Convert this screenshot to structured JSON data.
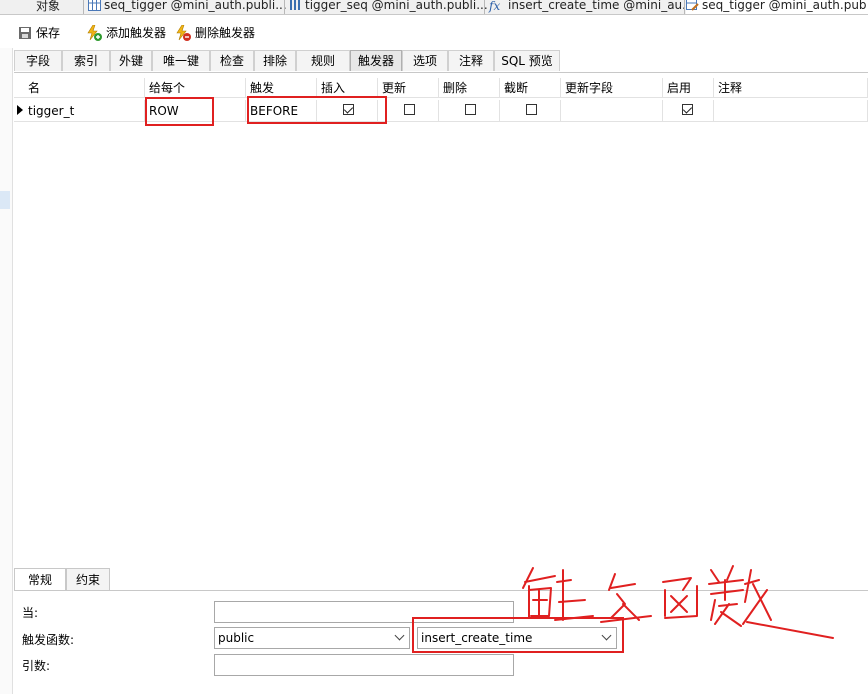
{
  "object_tabs": [
    {
      "label": "对象",
      "icon": "none"
    },
    {
      "label": "seq_tigger @mini_auth.publi...",
      "icon": "table-icon"
    },
    {
      "label": "tigger_seq @mini_auth.publi...",
      "icon": "sequence-icon"
    },
    {
      "label": "insert_create_time @mini_au...",
      "icon": "function-icon"
    },
    {
      "label": "seq_tigger @mini_auth.pub",
      "icon": "table-design-icon"
    }
  ],
  "toolbar": {
    "save_label": "保存",
    "add_trigger_label": "添加触发器",
    "delete_trigger_label": "删除触发器"
  },
  "design_tabs": [
    "字段",
    "索引",
    "外键",
    "唯一键",
    "检查",
    "排除",
    "规则",
    "触发器",
    "选项",
    "注释",
    "SQL 预览"
  ],
  "active_design_tab": "触发器",
  "grid": {
    "columns": [
      "名",
      "给每个",
      "触发",
      "插入",
      "更新",
      "删除",
      "截断",
      "更新字段",
      "启用",
      "注释"
    ],
    "rows": [
      {
        "name": "tigger_t",
        "for_each": "ROW",
        "fires": "BEFORE",
        "insert": true,
        "update": false,
        "delete": false,
        "truncate": false,
        "update_fields": "",
        "enabled": true,
        "comment": ""
      }
    ]
  },
  "bottom_tabs": [
    "常规",
    "约束"
  ],
  "active_bottom_tab": "常规",
  "form": {
    "when_label": "当:",
    "when_value": "",
    "trigger_function_label": "触发函数:",
    "function_schema": "public",
    "function_name": "insert_create_time",
    "args_label": "引数:",
    "args_value": ""
  },
  "colors": {
    "annotation_red": "#e02020",
    "tab_bar_bg": "#f0f0f0"
  }
}
